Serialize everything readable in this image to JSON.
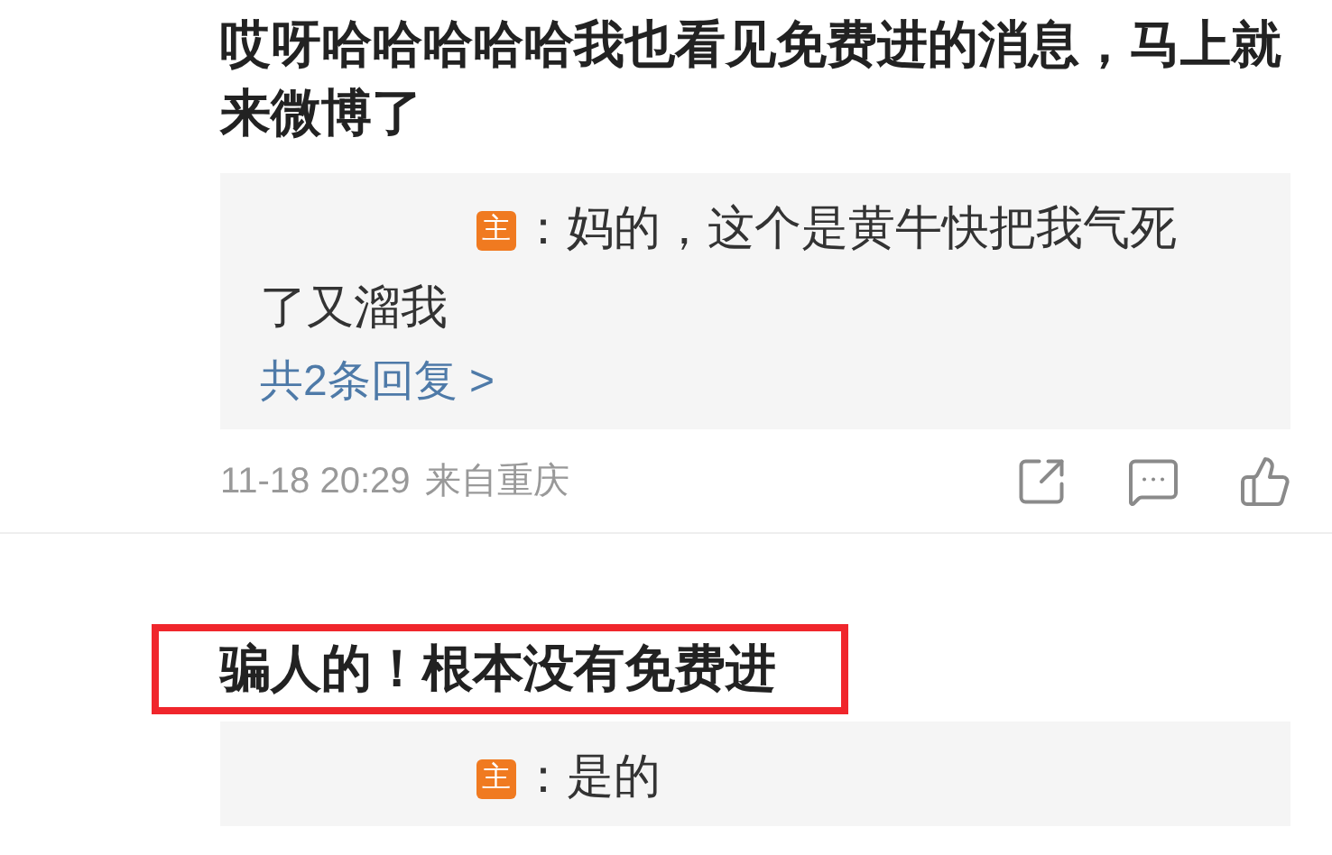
{
  "comments": [
    {
      "text": "哎呀哈哈哈哈哈我也看见免费进的消息，马上就来微博了",
      "highlighted": false,
      "replies": [
        {
          "badge": "主",
          "text": "：妈的，这个是黄牛快把我气死了又溜我"
        }
      ],
      "reply_count": "共2条回复 >",
      "time": "11-18 20:29",
      "source": "来自重庆"
    },
    {
      "text": "骗人的！根本没有免费进",
      "highlighted": true,
      "replies": [
        {
          "badge": "主",
          "text": "：是的"
        }
      ]
    }
  ]
}
